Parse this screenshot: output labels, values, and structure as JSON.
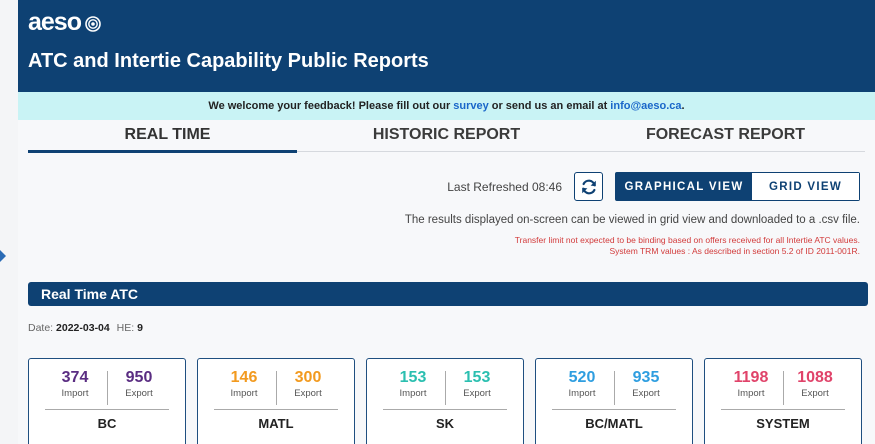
{
  "header": {
    "logo_text": "aeso",
    "title": "ATC and Intertie Capability Public Reports"
  },
  "feedback": {
    "prefix": "We welcome your feedback! Please fill out our",
    "survey_link": "survey",
    "middle": "or send us an email at",
    "email_link": "info@aeso.ca",
    "suffix": "."
  },
  "tabs": [
    {
      "label": "REAL TIME",
      "active": true
    },
    {
      "label": "HISTORIC REPORT",
      "active": false
    },
    {
      "label": "FORECAST REPORT",
      "active": false
    }
  ],
  "controls": {
    "last_refreshed": "Last Refreshed 08:46",
    "graphical_view": "GRAPHICAL VIEW",
    "grid_view": "GRID VIEW"
  },
  "info": {
    "main": "The results displayed on-screen can be viewed in grid view and downloaded to a .csv file.",
    "note1": "Transfer limit not expected to be binding based on offers received for all Intertie ATC values.",
    "note2": "System TRM values : As described in section 5.2 of ID 2011-001R."
  },
  "section": {
    "title": "Real Time ATC"
  },
  "date_line": {
    "date_label": "Date:",
    "date_value": "2022-03-04",
    "he_label": "HE:",
    "he_value": "9"
  },
  "cards": [
    {
      "name": "BC",
      "import": "374",
      "export": "950",
      "import_label": "Import",
      "export_label": "Export",
      "color": "#5a2d82"
    },
    {
      "name": "MATL",
      "import": "146",
      "export": "300",
      "import_label": "Import",
      "export_label": "Export",
      "color": "#f29a1f"
    },
    {
      "name": "SK",
      "import": "153",
      "export": "153",
      "import_label": "Import",
      "export_label": "Export",
      "color": "#2bbfb0"
    },
    {
      "name": "BC/MATL",
      "import": "520",
      "export": "935",
      "import_label": "Import",
      "export_label": "Export",
      "color": "#2f9ee0"
    },
    {
      "name": "SYSTEM",
      "import": "1198",
      "export": "1088",
      "import_label": "Import",
      "export_label": "Export",
      "color": "#e0436a"
    }
  ],
  "colors": {
    "brand": "#0e4173",
    "feedback_bg": "#c9f3f5",
    "link": "#1a66c9",
    "note_red": "#d23b3b"
  },
  "icons": {
    "logo_mark": "target-logo-icon",
    "refresh": "refresh-icon",
    "side_nav": "triangle-right-icon"
  }
}
